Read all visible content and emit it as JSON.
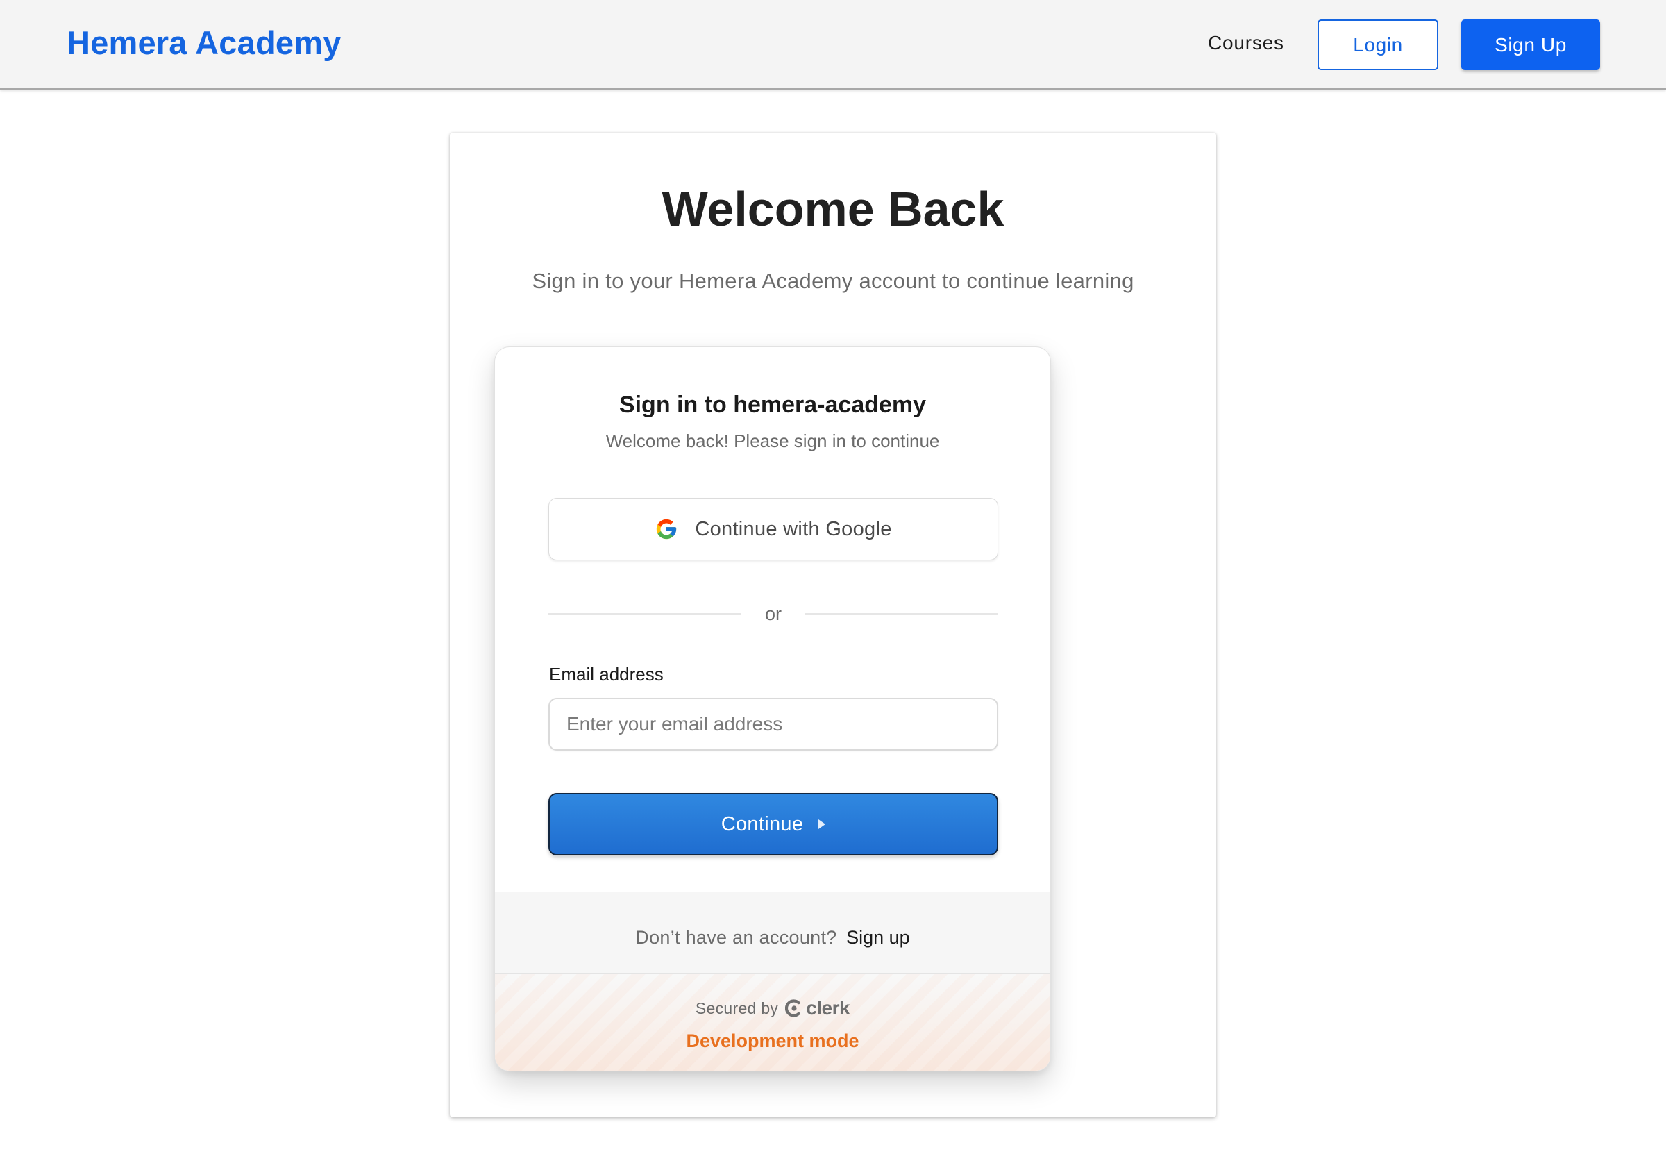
{
  "header": {
    "brand": "Hemera Academy",
    "nav_courses": "Courses",
    "login_label": "Login",
    "signup_label": "Sign Up"
  },
  "page": {
    "title": "Welcome Back",
    "subtitle": "Sign in to your Hemera Academy account to continue learning"
  },
  "signin": {
    "title": "Sign in to hemera-academy",
    "subtitle": "Welcome back! Please sign in to continue",
    "google_label": "Continue with Google",
    "google_icon": "google-logo-icon",
    "divider_text": "or",
    "email_label": "Email address",
    "email_placeholder": "Enter your email address",
    "email_value": "",
    "continue_label": "Continue",
    "continue_icon": "caret-right-icon",
    "signup_prompt": "Don’t have an account?",
    "signup_link": "Sign up",
    "secured_by": "Secured by",
    "provider_name": "clerk",
    "provider_icon": "clerk-logo-icon",
    "dev_mode": "Development mode"
  },
  "colors": {
    "brand_blue": "#1565e0",
    "primary_button": "#0d62f0",
    "continue_button": "#2a7fd9",
    "dev_mode_orange": "#e8701f"
  }
}
